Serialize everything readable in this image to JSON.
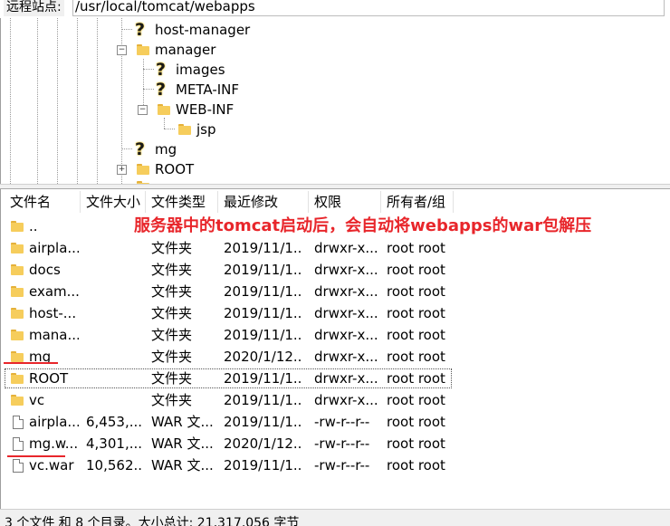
{
  "address_bar": {
    "label": "远程站点:",
    "path": "/usr/local/tomcat/webapps"
  },
  "tree": {
    "items": [
      {
        "label": "host-manager",
        "icon": "question-folder-icon"
      },
      {
        "label": "manager",
        "icon": "folder-icon",
        "expander": "−"
      },
      {
        "label": "images",
        "icon": "question-folder-icon"
      },
      {
        "label": "META-INF",
        "icon": "question-folder-icon"
      },
      {
        "label": "WEB-INF",
        "icon": "folder-icon",
        "expander": "−"
      },
      {
        "label": "jsp",
        "icon": "folder-icon"
      },
      {
        "label": "mg",
        "icon": "question-folder-icon"
      },
      {
        "label": "ROOT",
        "icon": "folder-icon",
        "expander": "+"
      }
    ]
  },
  "file_list": {
    "columns": [
      "文件名",
      "文件大小",
      "文件类型",
      "最近修改",
      "权限",
      "所有者/组"
    ],
    "rows": [
      {
        "name": "..",
        "size": "",
        "type": "",
        "modified": "",
        "perms": "",
        "owner": "",
        "icon": "folder-icon"
      },
      {
        "name": "airpla...",
        "size": "",
        "type": "文件夹",
        "modified": "2019/11/1...",
        "perms": "drwxr-x...",
        "owner": "root root",
        "icon": "folder-icon"
      },
      {
        "name": "docs",
        "size": "",
        "type": "文件夹",
        "modified": "2019/11/1...",
        "perms": "drwxr-x...",
        "owner": "root root",
        "icon": "folder-icon"
      },
      {
        "name": "exam...",
        "size": "",
        "type": "文件夹",
        "modified": "2019/11/1...",
        "perms": "drwxr-x...",
        "owner": "root root",
        "icon": "folder-icon"
      },
      {
        "name": "host-...",
        "size": "",
        "type": "文件夹",
        "modified": "2019/11/1...",
        "perms": "drwxr-x...",
        "owner": "root root",
        "icon": "folder-icon"
      },
      {
        "name": "mana...",
        "size": "",
        "type": "文件夹",
        "modified": "2019/11/1...",
        "perms": "drwxr-x...",
        "owner": "root root",
        "icon": "folder-icon"
      },
      {
        "name": "mg",
        "size": "",
        "type": "文件夹",
        "modified": "2020/1/12...",
        "perms": "drwxr-x...",
        "owner": "root root",
        "icon": "folder-icon"
      },
      {
        "name": "ROOT",
        "size": "",
        "type": "文件夹",
        "modified": "2019/11/1...",
        "perms": "drwxr-x...",
        "owner": "root root",
        "icon": "folder-icon"
      },
      {
        "name": "vc",
        "size": "",
        "type": "文件夹",
        "modified": "2019/11/1...",
        "perms": "drwxr-x...",
        "owner": "root root",
        "icon": "folder-icon"
      },
      {
        "name": "airpla...",
        "size": "6,453,...",
        "type": "WAR 文...",
        "modified": "2019/11/1...",
        "perms": "-rw-r--r--",
        "owner": "root root",
        "icon": "file-icon"
      },
      {
        "name": "mg.w...",
        "size": "4,301,...",
        "type": "WAR 文...",
        "modified": "2020/1/12...",
        "perms": "-rw-r--r--",
        "owner": "root root",
        "icon": "file-icon"
      },
      {
        "name": "vc.war",
        "size": "10,562...",
        "type": "WAR 文...",
        "modified": "2019/11/1...",
        "perms": "-rw-r--r--",
        "owner": "root root",
        "icon": "file-icon"
      }
    ]
  },
  "annotation": {
    "text": "服务器中的tomcat启动后，会自动将webapps的war包解压",
    "color": "#e8262b"
  },
  "status_bar": {
    "text": "3 个文件 和 8 个目录。大小总计: 21,317,056 字节"
  }
}
